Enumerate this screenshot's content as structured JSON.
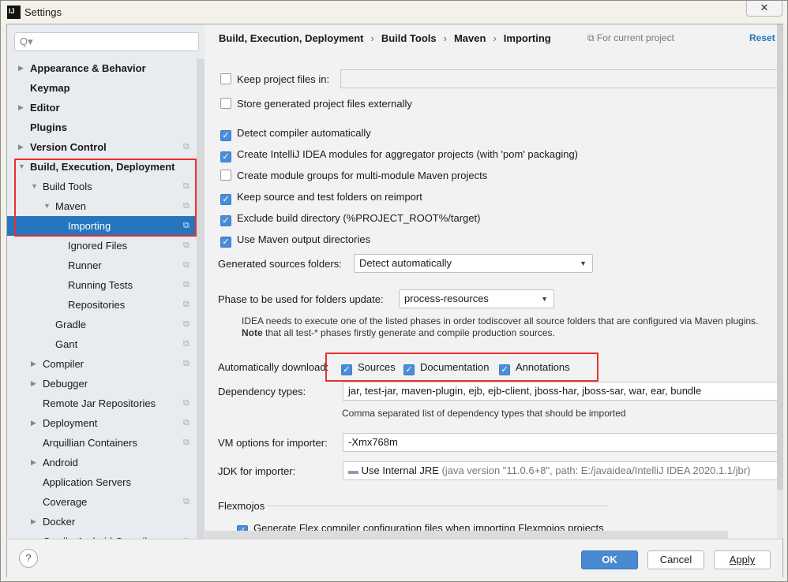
{
  "window": {
    "title": "Settings",
    "app_icon": "IJ",
    "close_label": "✕"
  },
  "sidebar": {
    "search_placeholder": "Q▾",
    "items": [
      {
        "label": "Appearance & Behavior",
        "bold": true,
        "arrow": "▶",
        "level": 0
      },
      {
        "label": "Keymap",
        "bold": true,
        "arrow": "",
        "level": 0
      },
      {
        "label": "Editor",
        "bold": true,
        "arrow": "▶",
        "level": 0
      },
      {
        "label": "Plugins",
        "bold": true,
        "arrow": "",
        "level": 0
      },
      {
        "label": "Version Control",
        "bold": true,
        "arrow": "▶",
        "level": 0,
        "copy": true
      },
      {
        "label": "Build, Execution, Deployment",
        "bold": true,
        "arrow": "▼",
        "level": 0
      },
      {
        "label": "Build Tools",
        "arrow": "▼",
        "level": 1,
        "copy": true
      },
      {
        "label": "Maven",
        "arrow": "▼",
        "level": 2,
        "copy": true
      },
      {
        "label": "Importing",
        "level": 3,
        "copy": true,
        "selected": true
      },
      {
        "label": "Ignored Files",
        "level": 3,
        "copy": true
      },
      {
        "label": "Runner",
        "level": 3,
        "copy": true
      },
      {
        "label": "Running Tests",
        "level": 3,
        "copy": true
      },
      {
        "label": "Repositories",
        "level": 3,
        "copy": true
      },
      {
        "label": "Gradle",
        "level": 2,
        "copy": true
      },
      {
        "label": "Gant",
        "level": 2,
        "copy": true
      },
      {
        "label": "Compiler",
        "arrow": "▶",
        "level": 1,
        "copy": true
      },
      {
        "label": "Debugger",
        "arrow": "▶",
        "level": 1
      },
      {
        "label": "Remote Jar Repositories",
        "level": 1,
        "copy": true
      },
      {
        "label": "Deployment",
        "arrow": "▶",
        "level": 1,
        "copy": true
      },
      {
        "label": "Arquillian Containers",
        "level": 1,
        "copy": true
      },
      {
        "label": "Android",
        "arrow": "▶",
        "level": 1
      },
      {
        "label": "Application Servers",
        "level": 1
      },
      {
        "label": "Coverage",
        "level": 1,
        "copy": true
      },
      {
        "label": "Docker",
        "arrow": "▶",
        "level": 1
      },
      {
        "label": "Gradle-Android Compiler",
        "level": 1,
        "copy": true
      }
    ]
  },
  "header": {
    "breadcrumb": [
      "Build, Execution, Deployment",
      "Build Tools",
      "Maven",
      "Importing"
    ],
    "for_current_project": "For current project",
    "reset": "Reset"
  },
  "options": {
    "keep_project_files": {
      "label": "Keep project files in:",
      "checked": false,
      "value": ""
    },
    "store_externally": {
      "label": "Store generated project files externally",
      "checked": false
    },
    "checkboxes": [
      {
        "label": "Detect compiler automatically",
        "checked": true
      },
      {
        "label": "Create IntelliJ IDEA modules for aggregator projects (with 'pom' packaging)",
        "checked": true
      },
      {
        "label": "Create module groups for multi-module Maven projects",
        "checked": false
      },
      {
        "label": "Keep source and test folders on reimport",
        "checked": true
      },
      {
        "label": "Exclude build directory (%PROJECT_ROOT%/target)",
        "checked": true
      },
      {
        "label": "Use Maven output directories",
        "checked": true
      }
    ],
    "generated_sources": {
      "label": "Generated sources folders:",
      "value": "Detect automatically"
    },
    "phase": {
      "label": "Phase to be used for folders update:",
      "value": "process-resources"
    },
    "phase_hint_1": "IDEA needs to execute one of the listed phases in order todiscover all source folders that are configured via Maven plugins.",
    "phase_hint_2_bold": "Note",
    "phase_hint_2": " that all test-* phases firstly generate and compile production sources.",
    "auto_download": {
      "label": "Automatically download:",
      "items": [
        {
          "label": "Sources",
          "checked": true
        },
        {
          "label": "Documentation",
          "checked": true
        },
        {
          "label": "Annotations",
          "checked": true
        }
      ]
    },
    "dependency_types": {
      "label": "Dependency types:",
      "value": "jar, test-jar, maven-plugin, ejb, ejb-client, jboss-har, jboss-sar, war, ear, bundle",
      "hint": "Comma separated list of dependency types that should be imported"
    },
    "vm_options": {
      "label": "VM options for importer:",
      "value": "-Xmx768m"
    },
    "jdk": {
      "label": "JDK for importer:",
      "value": "Use Internal JRE",
      "detail": " (java version \"11.0.6+8\", path: E:/javaidea/IntelliJ IDEA 2020.1.1/jbr)"
    },
    "flexmojos": {
      "title": "Flexmojos",
      "checkbox": {
        "label": "Generate Flex compiler configuration files when importing Flexmojos projects",
        "checked": true
      }
    }
  },
  "footer": {
    "help": "?",
    "ok": "OK",
    "cancel": "Cancel",
    "apply": "Apply"
  },
  "colors": {
    "accent": "#2675bf",
    "highlight_box": "#e8312f",
    "checkbox": "#4a8ddb"
  }
}
